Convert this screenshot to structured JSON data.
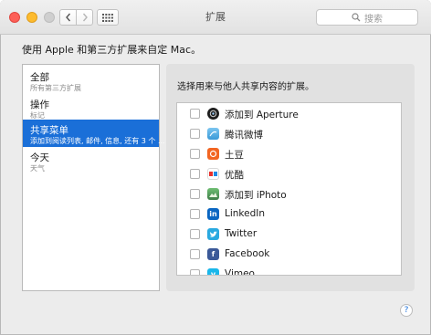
{
  "window": {
    "title": "扩展",
    "search_placeholder": "搜索",
    "description": "使用 Apple 和第三方扩展来自定 Mac。"
  },
  "sidebar": {
    "items": [
      {
        "title": "全部",
        "subtitle": "所有第三方扩展"
      },
      {
        "title": "操作",
        "subtitle": "标记"
      },
      {
        "title": "共享菜单",
        "subtitle": "添加到阅读列表, 邮件, 信息, 还有 3 个 ..."
      },
      {
        "title": "今天",
        "subtitle": "天气"
      }
    ],
    "selected": "共享菜单"
  },
  "panel": {
    "heading": "选择用来与他人共享内容的扩展。",
    "items": [
      {
        "label": "添加到 Aperture",
        "icon": "aperture-icon",
        "checked": false
      },
      {
        "label": "腾讯微博",
        "icon": "tencent-weibo-icon",
        "checked": false
      },
      {
        "label": "土豆",
        "icon": "tudou-icon",
        "checked": false
      },
      {
        "label": "优酷",
        "icon": "youku-icon",
        "checked": false
      },
      {
        "label": "添加到 iPhoto",
        "icon": "iphoto-icon",
        "checked": false
      },
      {
        "label": "LinkedIn",
        "icon": "linkedin-icon",
        "checked": false
      },
      {
        "label": "Twitter",
        "icon": "twitter-icon",
        "checked": false
      },
      {
        "label": "Facebook",
        "icon": "facebook-icon",
        "checked": false
      },
      {
        "label": "Vimeo",
        "icon": "vimeo-icon",
        "checked": false
      }
    ]
  },
  "colors": {
    "selection": "#1a6fd8",
    "close": "#fd5f57",
    "minimize": "#fdbb2e",
    "linkedin": "#0a66c2",
    "twitter": "#2aa9e0",
    "facebook": "#3b5998",
    "vimeo": "#1ab7ea",
    "tudou": "#f26522"
  }
}
